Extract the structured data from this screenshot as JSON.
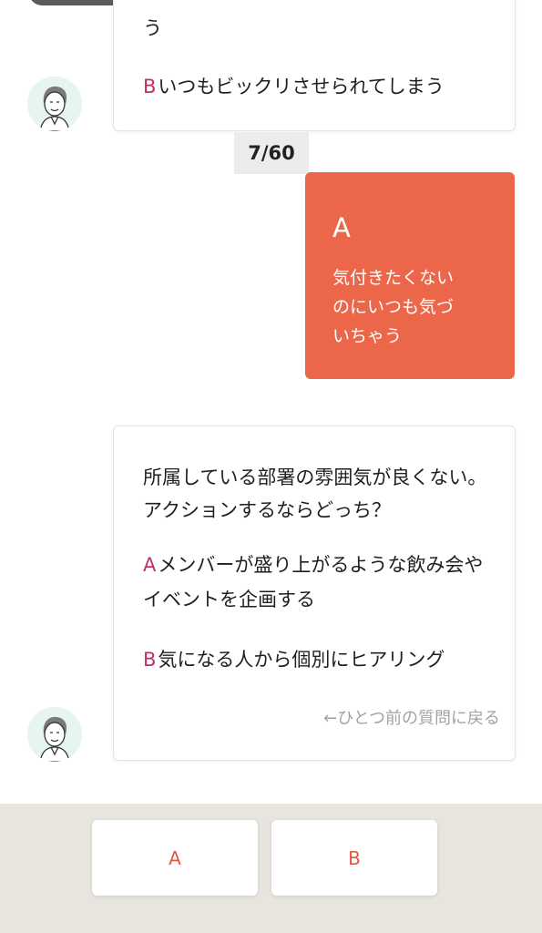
{
  "previous_question": {
    "partial_line": "う",
    "option_b_letter": "B",
    "option_b_text": "いつもビックリさせられてしまう"
  },
  "progress": {
    "counter": "7/60"
  },
  "user_answer": {
    "letter": "A",
    "text_lines": [
      "気付きたくない",
      "のにいつも気づ",
      "いちゃう"
    ]
  },
  "current_question": {
    "line1": "所属している部署の雰囲気が良くない。",
    "line2": "アクションするならどっち？",
    "option_a_letter": "A",
    "option_a_line1": "メンバーが盛り上がるような飲み会や",
    "option_a_line2": "イベントを企画する",
    "option_b_letter": "B",
    "option_b_text": "気になる人から個別にヒアリング",
    "back_link": "←ひとつ前の質問に戻る"
  },
  "footer": {
    "button_a": "A",
    "button_b": "B"
  },
  "colors": {
    "accent": "#ec664a",
    "option_letter": "#c0306a",
    "footer_bg": "#e8e5df"
  }
}
